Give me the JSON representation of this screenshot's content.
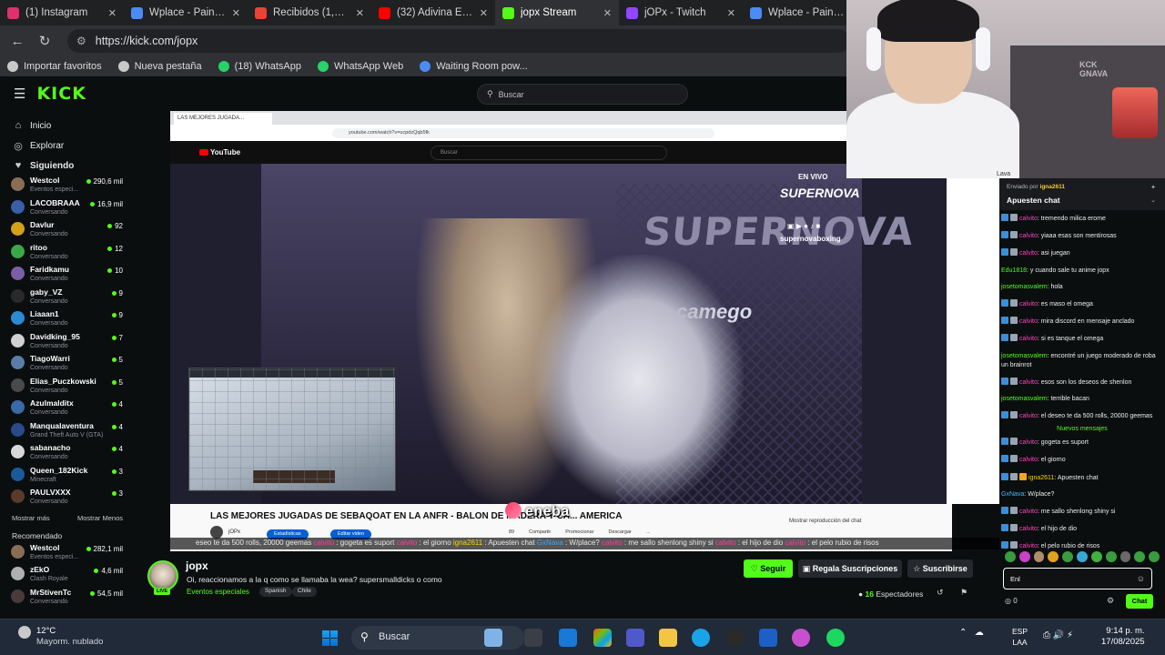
{
  "browser": {
    "tabs": [
      {
        "label": "(1) Instagram",
        "color": "#e1306c",
        "active": false
      },
      {
        "label": "Wplace - Paint the world",
        "color": "#4c8bf5",
        "active": false
      },
      {
        "label": "Recibidos (1,686)",
        "color": "#ea4335",
        "active": false
      },
      {
        "label": "(32) Adivina El Pal",
        "color": "#ff0000",
        "active": false
      },
      {
        "label": "jopx Stream",
        "color": "#53fc18",
        "active": true
      },
      {
        "label": "jOPx - Twitch",
        "color": "#9146ff",
        "active": false
      },
      {
        "label": "Wplace - Paint the world",
        "color": "#4c8bf5",
        "active": false
      }
    ],
    "url": "https://kick.com/jopx",
    "bookmarks": [
      {
        "label": "Importar favoritos",
        "color": "#c9c9c9"
      },
      {
        "label": "Nueva pestaña",
        "color": "#c9c9c9"
      },
      {
        "label": "(18) WhatsApp",
        "color": "#25d366"
      },
      {
        "label": "WhatsApp Web",
        "color": "#25d366"
      },
      {
        "label": "Waiting Room pow...",
        "color": "#4c8bf5"
      }
    ]
  },
  "kick": {
    "logo": "KICK",
    "search_placeholder": "Buscar",
    "nav": [
      {
        "label": "Inicio",
        "icon": "home-icon"
      },
      {
        "label": "Explorar",
        "icon": "compass-icon"
      },
      {
        "label": "Siguiendo",
        "icon": "heart-icon"
      }
    ],
    "following": [
      {
        "name": "Westcol",
        "sub": "Eventos especi...",
        "viewers": "290,6 mil",
        "color": "#8a6d55"
      },
      {
        "name": "LACOBRAAA",
        "sub": "Conversando",
        "viewers": "16,9 mil",
        "color": "#3a5fa8"
      },
      {
        "name": "Davlur",
        "sub": "Conversando",
        "viewers": "92",
        "color": "#d4a017"
      },
      {
        "name": "ritoo",
        "sub": "Conversando",
        "viewers": "12",
        "color": "#3aa84a"
      },
      {
        "name": "Faridkamu",
        "sub": "Conversando",
        "viewers": "10",
        "color": "#7a5fa8"
      },
      {
        "name": "gaby_VZ",
        "sub": "Conversando",
        "viewers": "9",
        "color": "#2a2a2a"
      },
      {
        "name": "Liaaan1",
        "sub": "Conversando",
        "viewers": "9",
        "color": "#2a8ad4"
      },
      {
        "name": "Davidking_95",
        "sub": "Conversando",
        "viewers": "7",
        "color": "#d0d0d0"
      },
      {
        "name": "TiagoWarri",
        "sub": "Conversando",
        "viewers": "5",
        "color": "#5a7da8"
      },
      {
        "name": "Elias_Puczkowski",
        "sub": "Conversando",
        "viewers": "5",
        "color": "#4a4a4a"
      },
      {
        "name": "Azulmalditx",
        "sub": "Conversando",
        "viewers": "4",
        "color": "#3a6aa8"
      },
      {
        "name": "Manqualaventura",
        "sub": "Grand Theft Auto V (GTA)",
        "viewers": "4",
        "color": "#2a4a88"
      },
      {
        "name": "sabanacho",
        "sub": "Conversando",
        "viewers": "4",
        "color": "#d8d8d8"
      },
      {
        "name": "Queen_182Kick",
        "sub": "Minecraft",
        "viewers": "3",
        "color": "#1a5a9a"
      },
      {
        "name": "PAULVXXX",
        "sub": "Conversando",
        "viewers": "3",
        "color": "#5a3a2a"
      }
    ],
    "show_more": "Mostrar más",
    "show_less": "Mostrar Menos",
    "recommended_title": "Recomendado",
    "recommended": [
      {
        "name": "Westcol",
        "sub": "Eventos especi...",
        "viewers": "282,1 mil",
        "color": "#8a6d55"
      },
      {
        "name": "zEkO",
        "sub": "Clash Royale",
        "viewers": "4,6 mil",
        "color": "#b0b0b0"
      },
      {
        "name": "MrStivenTc",
        "sub": "Conversando",
        "viewers": "54,5 mil",
        "color": "#4a3a3a"
      }
    ]
  },
  "youtube": {
    "tab_title": "LAS MEJORES JUGADA...",
    "url": "youtube.com/watch?v=ucpdzQqb5fk",
    "search_placeholder": "Buscar",
    "logo": "YouTube",
    "video_title": "LAS MEJORES JUGADAS DE SEBAQOAT EN LA ANFR - BALON DE MADERA Y CA... AMERICA",
    "channel": "jOPx",
    "btn_stats": "Estadísticas",
    "btn_edit": "Editar video",
    "actions": [
      "89",
      "Compartir",
      "Promocionar",
      "Descargar",
      "..."
    ],
    "show_chat": "Mostrar reproducción del chat",
    "overlay_live": "EN VIVO",
    "overlay_brand": "SUPERNOVA",
    "overlay_handle": "supernovaboxing",
    "scene_text": "SUPERNOVA",
    "scene_logo": "camego",
    "sponsor": "eneba"
  },
  "ticker": [
    {
      "t": "eseo te da 500 rolls, 20000 geemas ",
      "c": ""
    },
    {
      "t": "calvito",
      "c": "nn"
    },
    {
      "t": " : gogeta es suport ",
      "c": ""
    },
    {
      "t": "calvito",
      "c": "nn"
    },
    {
      "t": " : el giorno ",
      "c": ""
    },
    {
      "t": "igna2611",
      "c": "ny"
    },
    {
      "t": " : Apuesten chat ",
      "c": ""
    },
    {
      "t": "GxNava",
      "c": "nb"
    },
    {
      "t": " : W/place? ",
      "c": ""
    },
    {
      "t": "calvito",
      "c": "nn"
    },
    {
      "t": " : me sallo shenlong shiny si ",
      "c": ""
    },
    {
      "t": "calvito",
      "c": "nn"
    },
    {
      "t": " : el hijo de dio ",
      "c": ""
    },
    {
      "t": "calvito",
      "c": "nn"
    },
    {
      "t": " : el pelo rubio de risos",
      "c": ""
    }
  ],
  "webcam": {
    "text1": "KCK",
    "text2": "GNAVA",
    "caption": "Lava"
  },
  "chat": {
    "pinned_by": "Enviado por",
    "pinned_user": "igna2611",
    "pinned_message": "Apuesten chat",
    "new_messages_label": "Nuevos mensajes",
    "messages_before": [
      {
        "user": "calvito",
        "cls": "u-pink",
        "badges": 2,
        "text": "tremendo milica erome"
      },
      {
        "user": "calvito",
        "cls": "u-pink",
        "badges": 2,
        "text": "yiaaa esas son mentirosas"
      },
      {
        "user": "calvito",
        "cls": "u-pink",
        "badges": 2,
        "text": "asi juegan"
      },
      {
        "user": "Edu1818",
        "cls": "u-green",
        "badges": 0,
        "text": "y cuando sale tu anime jopx"
      },
      {
        "user": "josetomasvalem",
        "cls": "u-green",
        "badges": 0,
        "text": "hola"
      },
      {
        "user": "calvito",
        "cls": "u-pink",
        "badges": 2,
        "text": "es maso el omega"
      },
      {
        "user": "calvito",
        "cls": "u-pink",
        "badges": 2,
        "text": "mira discord en mensaje anclado"
      },
      {
        "user": "calvito",
        "cls": "u-pink",
        "badges": 2,
        "text": "si es tanque el omega"
      },
      {
        "user": "josetomasvalem",
        "cls": "u-green",
        "badges": 0,
        "text": "encontré un juego moderado de roba un brainrot"
      },
      {
        "user": "calvito",
        "cls": "u-pink",
        "badges": 2,
        "text": "esos son los deseos de shenlon"
      },
      {
        "user": "josetomasvalem",
        "cls": "u-green",
        "badges": 0,
        "text": "terrible bacan"
      },
      {
        "user": "calvito",
        "cls": "u-pink",
        "badges": 2,
        "text": "el deseo te da 500 rolls, 20000 geemas"
      }
    ],
    "messages_after": [
      {
        "user": "calvito",
        "cls": "u-pink",
        "badges": 2,
        "text": "gogeta es suport"
      },
      {
        "user": "calvito",
        "cls": "u-pink",
        "badges": 2,
        "text": "el giorno"
      },
      {
        "user": "igna2611",
        "cls": "u-yel",
        "badges": 3,
        "text": "Apuesten chat"
      },
      {
        "user": "GxNava",
        "cls": "u-blue",
        "badges": 0,
        "text": "W/place?"
      },
      {
        "user": "calvito",
        "cls": "u-pink",
        "badges": 2,
        "text": "me sallo shenlong shiny si"
      },
      {
        "user": "calvito",
        "cls": "u-pink",
        "badges": 2,
        "text": "el hijo de dio"
      },
      {
        "user": "calvito",
        "cls": "u-pink",
        "badges": 2,
        "text": "el pelo rubio de risos"
      }
    ],
    "input_value": "Enl",
    "points": "0",
    "send_label": "Chat"
  },
  "stream": {
    "name": "jopx",
    "live_badge": "LIVE",
    "title": "Oi, reaccionamos a la q como se llamaba la wea? supersmalldicks o como",
    "category": "Eventos especiales",
    "tags": [
      "Spanish",
      "Chile"
    ],
    "follow": "Seguir",
    "gift": "Regala Suscripciones",
    "subscribe": "Suscribirse",
    "viewers_count": "16",
    "viewers_label": "Espectadores"
  },
  "taskbar": {
    "temp": "12°C",
    "weather": "Mayorm. nublado",
    "search": "Buscar",
    "lang1": "ESP",
    "lang2": "LAA",
    "time": "9:14 p. m.",
    "date": "17/08/2025"
  }
}
